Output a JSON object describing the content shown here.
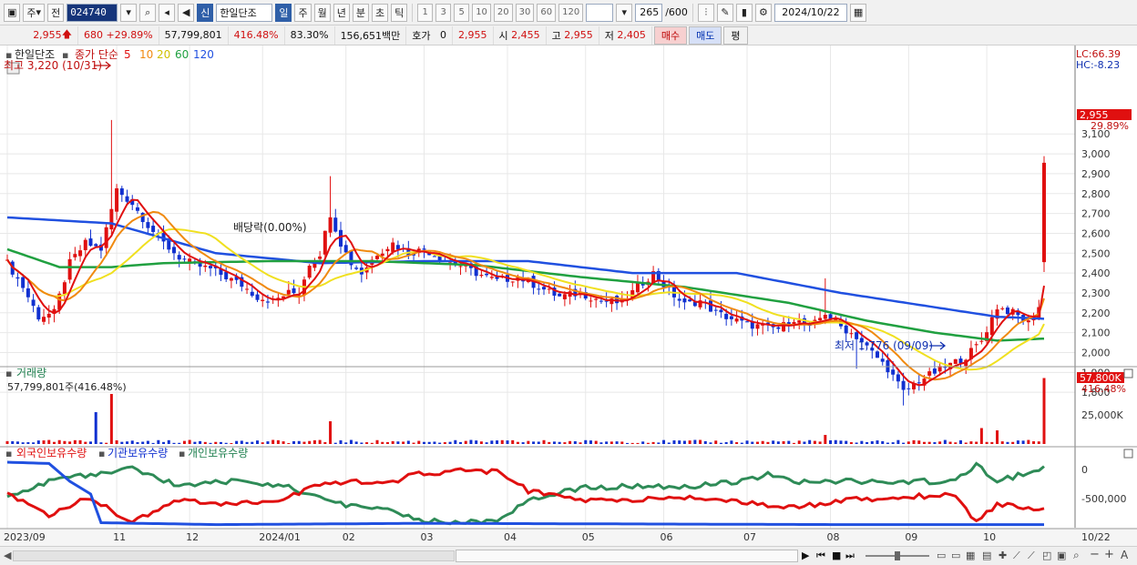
{
  "toolbar": {
    "period_select": "주",
    "prev_label": "전",
    "stock_code": "024740",
    "credit_badge": "신",
    "stock_name": "한일단조",
    "period_tabs": [
      "일",
      "주",
      "월",
      "년",
      "분",
      "초",
      "틱"
    ],
    "active_period": "일",
    "interval_buttons": [
      "1",
      "3",
      "5",
      "10",
      "20",
      "30",
      "60",
      "120"
    ],
    "count_display": "265",
    "count_total": "/600",
    "date": "2024/10/22"
  },
  "quote": {
    "price": "2,955",
    "change": "680",
    "change_rate": "+29.89%",
    "volume": "57,799,801",
    "volume_ratio": "416.48%",
    "turnover": "83.30%",
    "amount": "156,651백만",
    "hoga_label": "호가",
    "hoga_value": "0",
    "current": "2,955",
    "open_label": "시",
    "open": "2,455",
    "high_label": "고",
    "high": "2,955",
    "low_label": "저",
    "low": "2,405",
    "buy_button": "매수",
    "sell_button": "매도",
    "eval_button": "평"
  },
  "price_panel": {
    "legend_name": "한일단조",
    "legend_ma_label": "종가 단순",
    "legend_ma_periods": [
      "5",
      "10",
      "20",
      "60",
      "120"
    ],
    "legend_ma_colors": [
      "#e01010",
      "#f08a10",
      "#f0e020",
      "#20a040",
      "#2050e0"
    ],
    "high_marker": "최고 3,220 (10/31)",
    "low_marker": "최저 1,776 (09/09)",
    "dividend_marker": "배당락(0.00%)",
    "lc_label": "LC:66.39",
    "hc_label": "HC:-8.23",
    "y_ticks": [
      "3,100",
      "3,000",
      "2,900",
      "2,800",
      "2,700",
      "2,600",
      "2,500",
      "2,400",
      "2,300",
      "2,200",
      "2,100",
      "2,000",
      "1,900",
      "1,800"
    ],
    "current_price_tag": "2,955",
    "current_change_tag": "29.89%",
    "up_color": "#e01010",
    "down_color": "#1030d0"
  },
  "volume_panel": {
    "title": "거래량",
    "value_label": "57,799,801주(416.48%)",
    "tag_value": "57,800K",
    "tag_ratio": "416.48%",
    "y_tick": "25,000K"
  },
  "holding_panel": {
    "legend": [
      "외국인보유수량",
      "기관보유수량",
      "개인보유수량"
    ],
    "legend_colors": [
      "#e01010",
      "#1030d0",
      "#208050"
    ],
    "y_ticks": [
      "0",
      "-500,000"
    ]
  },
  "x_axis": {
    "labels": [
      "2023/09",
      "11",
      "12",
      "2024/01",
      "02",
      "03",
      "04",
      "05",
      "06",
      "07",
      "08",
      "09",
      "10"
    ],
    "last_label": "10/22"
  },
  "chart_data": {
    "type": "candlestick",
    "series_price_knots": [
      [
        0,
        2450
      ],
      [
        3,
        2330
      ],
      [
        6,
        2180
      ],
      [
        9,
        2200
      ],
      [
        12,
        2450
      ],
      [
        15,
        2550
      ],
      [
        18,
        2520
      ],
      [
        21,
        2820
      ],
      [
        24,
        2750
      ],
      [
        27,
        2640
      ],
      [
        30,
        2550
      ],
      [
        33,
        2480
      ],
      [
        36,
        2440
      ],
      [
        39,
        2420
      ],
      [
        42,
        2380
      ],
      [
        45,
        2340
      ],
      [
        48,
        2280
      ],
      [
        51,
        2260
      ],
      [
        54,
        2300
      ],
      [
        56,
        2300
      ],
      [
        58,
        2450
      ],
      [
        60,
        2500
      ],
      [
        62,
        2700
      ],
      [
        64,
        2550
      ],
      [
        66,
        2450
      ],
      [
        68,
        2400
      ],
      [
        71,
        2500
      ],
      [
        74,
        2550
      ],
      [
        77,
        2500
      ],
      [
        80,
        2520
      ],
      [
        83,
        2480
      ],
      [
        86,
        2450
      ],
      [
        90,
        2400
      ],
      [
        94,
        2360
      ],
      [
        98,
        2380
      ],
      [
        102,
        2330
      ],
      [
        106,
        2280
      ],
      [
        110,
        2300
      ],
      [
        114,
        2260
      ],
      [
        118,
        2250
      ],
      [
        121,
        2330
      ],
      [
        124,
        2400
      ],
      [
        127,
        2310
      ],
      [
        130,
        2240
      ],
      [
        133,
        2260
      ],
      [
        136,
        2200
      ],
      [
        139,
        2170
      ],
      [
        142,
        2140
      ],
      [
        145,
        2130
      ],
      [
        148,
        2120
      ],
      [
        151,
        2170
      ],
      [
        154,
        2120
      ],
      [
        157,
        2200
      ],
      [
        160,
        2130
      ],
      [
        163,
        2080
      ],
      [
        166,
        2000
      ],
      [
        169,
        1920
      ],
      [
        172,
        1800
      ],
      [
        175,
        1860
      ],
      [
        178,
        1900
      ],
      [
        181,
        1940
      ],
      [
        184,
        1980
      ],
      [
        187,
        2060
      ],
      [
        190,
        2230
      ],
      [
        193,
        2200
      ],
      [
        196,
        2150
      ],
      [
        198,
        2230
      ],
      [
        199,
        2955
      ]
    ],
    "ma120_knots": [
      [
        0,
        2680
      ],
      [
        20,
        2650
      ],
      [
        40,
        2500
      ],
      [
        60,
        2450
      ],
      [
        80,
        2460
      ],
      [
        100,
        2460
      ],
      [
        120,
        2400
      ],
      [
        140,
        2400
      ],
      [
        160,
        2300
      ],
      [
        175,
        2240
      ],
      [
        190,
        2180
      ],
      [
        199,
        2170
      ]
    ],
    "ma60_knots": [
      [
        0,
        2520
      ],
      [
        10,
        2430
      ],
      [
        20,
        2430
      ],
      [
        30,
        2450
      ],
      [
        50,
        2460
      ],
      [
        70,
        2460
      ],
      [
        90,
        2440
      ],
      [
        110,
        2380
      ],
      [
        130,
        2330
      ],
      [
        150,
        2250
      ],
      [
        165,
        2160
      ],
      [
        178,
        2100
      ],
      [
        190,
        2060
      ],
      [
        199,
        2070
      ]
    ],
    "volume_spikes": [
      [
        17,
        0.7
      ],
      [
        20,
        1.1
      ],
      [
        62,
        0.5
      ],
      [
        157,
        0.2
      ],
      [
        187,
        0.35
      ],
      [
        190,
        0.3
      ],
      [
        199,
        1.45
      ]
    ],
    "foreign_knots": [
      [
        0,
        0.5
      ],
      [
        8,
        0.82
      ],
      [
        16,
        0.55
      ],
      [
        24,
        0.95
      ],
      [
        32,
        0.6
      ],
      [
        44,
        0.65
      ],
      [
        52,
        0.6
      ],
      [
        60,
        0.35
      ],
      [
        66,
        0.3
      ],
      [
        72,
        0.35
      ],
      [
        78,
        0.2
      ],
      [
        88,
        0.12
      ],
      [
        94,
        0.15
      ],
      [
        100,
        0.45
      ],
      [
        110,
        0.6
      ],
      [
        120,
        0.6
      ],
      [
        130,
        0.55
      ],
      [
        140,
        0.6
      ],
      [
        146,
        0.7
      ],
      [
        152,
        0.7
      ],
      [
        160,
        0.6
      ],
      [
        172,
        0.55
      ],
      [
        182,
        0.5
      ],
      [
        186,
        0.95
      ],
      [
        190,
        0.65
      ],
      [
        199,
        0.75
      ]
    ],
    "retail_knots": [
      [
        0,
        0.55
      ],
      [
        8,
        0.3
      ],
      [
        16,
        0.2
      ],
      [
        24,
        0.1
      ],
      [
        32,
        0.35
      ],
      [
        44,
        0.3
      ],
      [
        52,
        0.35
      ],
      [
        60,
        0.55
      ],
      [
        66,
        0.7
      ],
      [
        72,
        0.7
      ],
      [
        78,
        0.9
      ],
      [
        88,
        0.95
      ],
      [
        94,
        0.9
      ],
      [
        100,
        0.6
      ],
      [
        110,
        0.4
      ],
      [
        120,
        0.38
      ],
      [
        130,
        0.4
      ],
      [
        140,
        0.3
      ],
      [
        146,
        0.2
      ],
      [
        152,
        0.3
      ],
      [
        160,
        0.3
      ],
      [
        172,
        0.3
      ],
      [
        182,
        0.3
      ],
      [
        186,
        0.05
      ],
      [
        190,
        0.3
      ],
      [
        199,
        0.1
      ]
    ],
    "institution_knots": [
      [
        0,
        0.0
      ],
      [
        8,
        0.02
      ],
      [
        12,
        0.3
      ],
      [
        16,
        0.5
      ],
      [
        18,
        0.95
      ],
      [
        40,
        0.98
      ],
      [
        80,
        0.96
      ],
      [
        120,
        0.97
      ],
      [
        160,
        0.98
      ],
      [
        199,
        0.98
      ]
    ],
    "ylim": [
      1700,
      3200
    ]
  }
}
